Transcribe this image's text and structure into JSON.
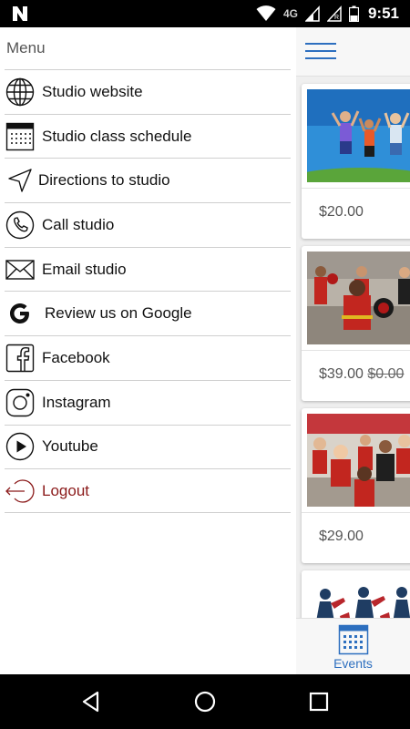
{
  "status_bar": {
    "network": "4G",
    "time": "9:51"
  },
  "drawer": {
    "title": "Menu",
    "items": [
      {
        "label": "Studio website",
        "icon": "globe-icon"
      },
      {
        "label": "Studio class schedule",
        "icon": "calendar-icon"
      },
      {
        "label": "Directions to studio",
        "icon": "navigation-arrow-icon"
      },
      {
        "label": "Call studio",
        "icon": "phone-icon"
      },
      {
        "label": "Email studio",
        "icon": "envelope-icon"
      },
      {
        "label": "Review us on Google",
        "icon": "google-icon"
      },
      {
        "label": "Facebook",
        "icon": "facebook-icon"
      },
      {
        "label": "Instagram",
        "icon": "instagram-icon"
      },
      {
        "label": "Youtube",
        "icon": "youtube-play-icon"
      },
      {
        "label": "Logout",
        "icon": "logout-icon"
      }
    ]
  },
  "events_panel": {
    "cards": [
      {
        "price": "$20.00",
        "old_price": ""
      },
      {
        "price": "$39.00",
        "old_price": "$0.00"
      },
      {
        "price": "$29.00",
        "old_price": ""
      }
    ],
    "bottom_tab": {
      "label": "Events",
      "icon": "calendar-icon"
    }
  },
  "colors": {
    "accent": "#2d6fbf",
    "logout": "#8b1a1a",
    "status_bar": "#000000",
    "nav_bar": "#000000"
  },
  "system_nav": {
    "back": "back-icon",
    "home": "home-icon",
    "recents": "recents-icon"
  }
}
